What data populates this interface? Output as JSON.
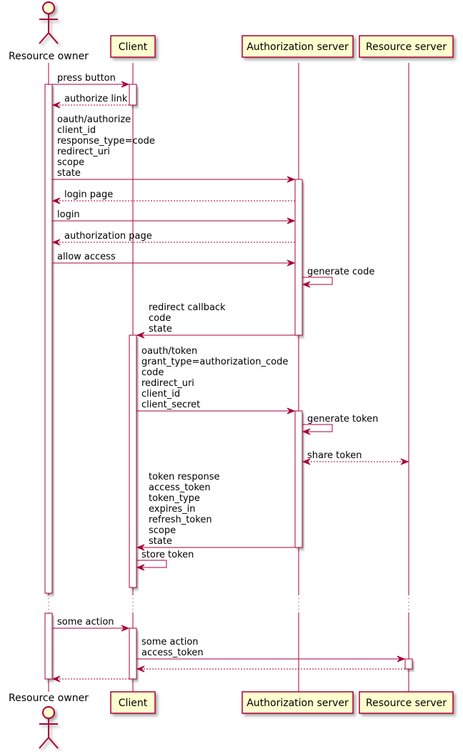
{
  "diagram": {
    "type": "sequence",
    "colors": {
      "line": "#A80036",
      "participant_fill": "#FEFECE",
      "activation_fill": "#FFFFFF",
      "text": "#000000"
    },
    "participants": [
      {
        "id": "owner",
        "label": "Resource owner",
        "kind": "actor"
      },
      {
        "id": "client",
        "label": "Client",
        "kind": "participant"
      },
      {
        "id": "auth",
        "label": "Authorization server",
        "kind": "participant"
      },
      {
        "id": "resource",
        "label": "Resource server",
        "kind": "participant"
      }
    ],
    "messages": [
      {
        "from": "owner",
        "to": "client",
        "style": "solid",
        "lines": [
          "press button"
        ]
      },
      {
        "from": "client",
        "to": "owner",
        "style": "dashed",
        "lines": [
          "authorize link"
        ]
      },
      {
        "from": "owner",
        "to": "auth",
        "style": "solid",
        "lines": [
          "oauth/authorize",
          "client_id",
          "response_type=code",
          "redirect_uri",
          "scope",
          "state"
        ]
      },
      {
        "from": "auth",
        "to": "owner",
        "style": "dashed",
        "lines": [
          "login page"
        ]
      },
      {
        "from": "owner",
        "to": "auth",
        "style": "solid",
        "lines": [
          "login"
        ]
      },
      {
        "from": "auth",
        "to": "owner",
        "style": "dashed",
        "lines": [
          "authorization page"
        ]
      },
      {
        "from": "owner",
        "to": "auth",
        "style": "solid",
        "lines": [
          "allow access"
        ]
      },
      {
        "from": "auth",
        "to": "auth",
        "style": "solid",
        "lines": [
          "generate code"
        ]
      },
      {
        "from": "auth",
        "to": "client",
        "style": "solid",
        "lines": [
          "redirect callback",
          "code",
          "state"
        ]
      },
      {
        "from": "client",
        "to": "auth",
        "style": "solid",
        "lines": [
          "oauth/token",
          "grant_type=authorization_code",
          "code",
          "redirect_uri",
          "client_id",
          "client_secret"
        ]
      },
      {
        "from": "auth",
        "to": "auth",
        "style": "solid",
        "lines": [
          "generate token"
        ]
      },
      {
        "from": "auth",
        "to": "resource",
        "style": "dashed-both",
        "lines": [
          "share token"
        ]
      },
      {
        "from": "auth",
        "to": "client",
        "style": "solid",
        "lines": [
          "token response",
          "access_token",
          "token_type",
          "expires_in",
          "refresh_token",
          "scope",
          "state"
        ]
      },
      {
        "from": "client",
        "to": "client",
        "style": "solid",
        "lines": [
          "store token"
        ]
      },
      {
        "from": "owner",
        "to": "client",
        "style": "solid",
        "lines": [
          "some action"
        ]
      },
      {
        "from": "client",
        "to": "resource",
        "style": "solid",
        "lines": [
          "some action",
          "access_token"
        ]
      },
      {
        "from": "resource",
        "to": "client",
        "style": "dashed",
        "lines": []
      },
      {
        "from": "client",
        "to": "owner",
        "style": "dashed",
        "lines": []
      }
    ],
    "delay_separator": "..."
  }
}
